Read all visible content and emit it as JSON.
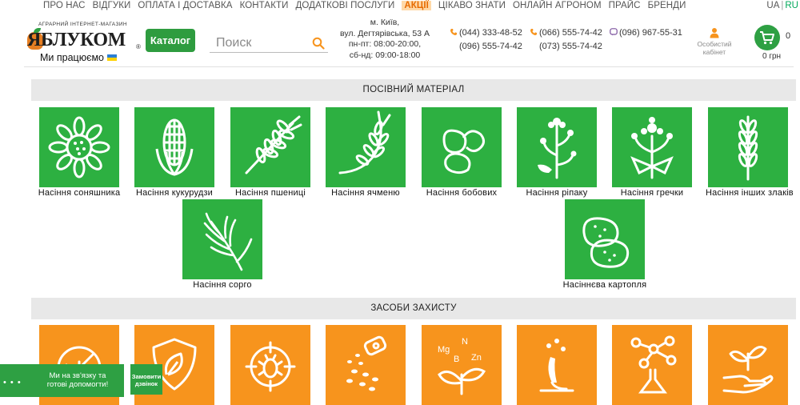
{
  "nav": {
    "items": [
      "ПРО НАС",
      "ВІДГУКИ",
      "ОПЛАТА І ДОСТАВКА",
      "КОНТАКТИ",
      "ДОДАТКОВІ ПОСЛУГИ",
      "АКЦІЇ",
      "ЦІКАВО ЗНАТИ",
      "ОНЛАЙН АГРОНОМ",
      "ПРАЙС",
      "БРЕНДИ"
    ],
    "highlight_index": 5,
    "lang_ua": "UA",
    "lang_sep": "|",
    "lang_ru": "RU"
  },
  "logo": {
    "tagline": "АГРАРНИЙ ІНТЕРНЕТ-МАГАЗИН",
    "brand": "ЯБЛУКОМ",
    "reg": "®",
    "working": "Ми працюємо"
  },
  "header": {
    "catalog_label": "Каталог",
    "search_placeholder": "Поиск",
    "address": {
      "line1": "м. Київ,",
      "line2": "вул. Дегтярівська, 53 А",
      "line3": "пн-пт: 08:00-20:00,",
      "line4": "сб-нд: 09:00-18:00"
    },
    "phones": {
      "p1": "(044) 333-48-52",
      "p2": "(096) 555-74-42",
      "p3": "(066) 555-74-42",
      "p4": "(073) 555-74-42",
      "p5": "(096) 967-55-31"
    },
    "cabinet_line1": "Особистий",
    "cabinet_line2": "кабінет",
    "cart_count": "0",
    "cart_total": "0 грн"
  },
  "sections": {
    "seeds_title": "ПОСІВНИЙ МАТЕРІАЛ",
    "protection_title": "ЗАСОБИ ЗАХИСТУ"
  },
  "seeds": [
    "Насіння соняшника",
    "Насіння кукурудзи",
    "Насіння пшениці",
    "Насіння ячменю",
    "Насіння бобових",
    "Насіння ріпаку",
    "Насіння гречки",
    "Насіння інших злаків",
    "Насіння сорго",
    "Насіннєва картопля"
  ],
  "protection_icons": [
    "herbicide-icon",
    "fungicide-icon",
    "insecticide-icon",
    "seed-treatment-icon",
    "microfertilizer-icon",
    "growth-regulator-icon",
    "adjuvant-icon",
    "biopreparation-icon"
  ],
  "chat": {
    "text": "Ми на зв'язку та готові допомогти!",
    "dots": "• • •",
    "callback": "Замовити дзвінок"
  },
  "colors": {
    "green": "#2db041",
    "orange": "#f7941d",
    "accent_green": "#2e9c3f"
  }
}
